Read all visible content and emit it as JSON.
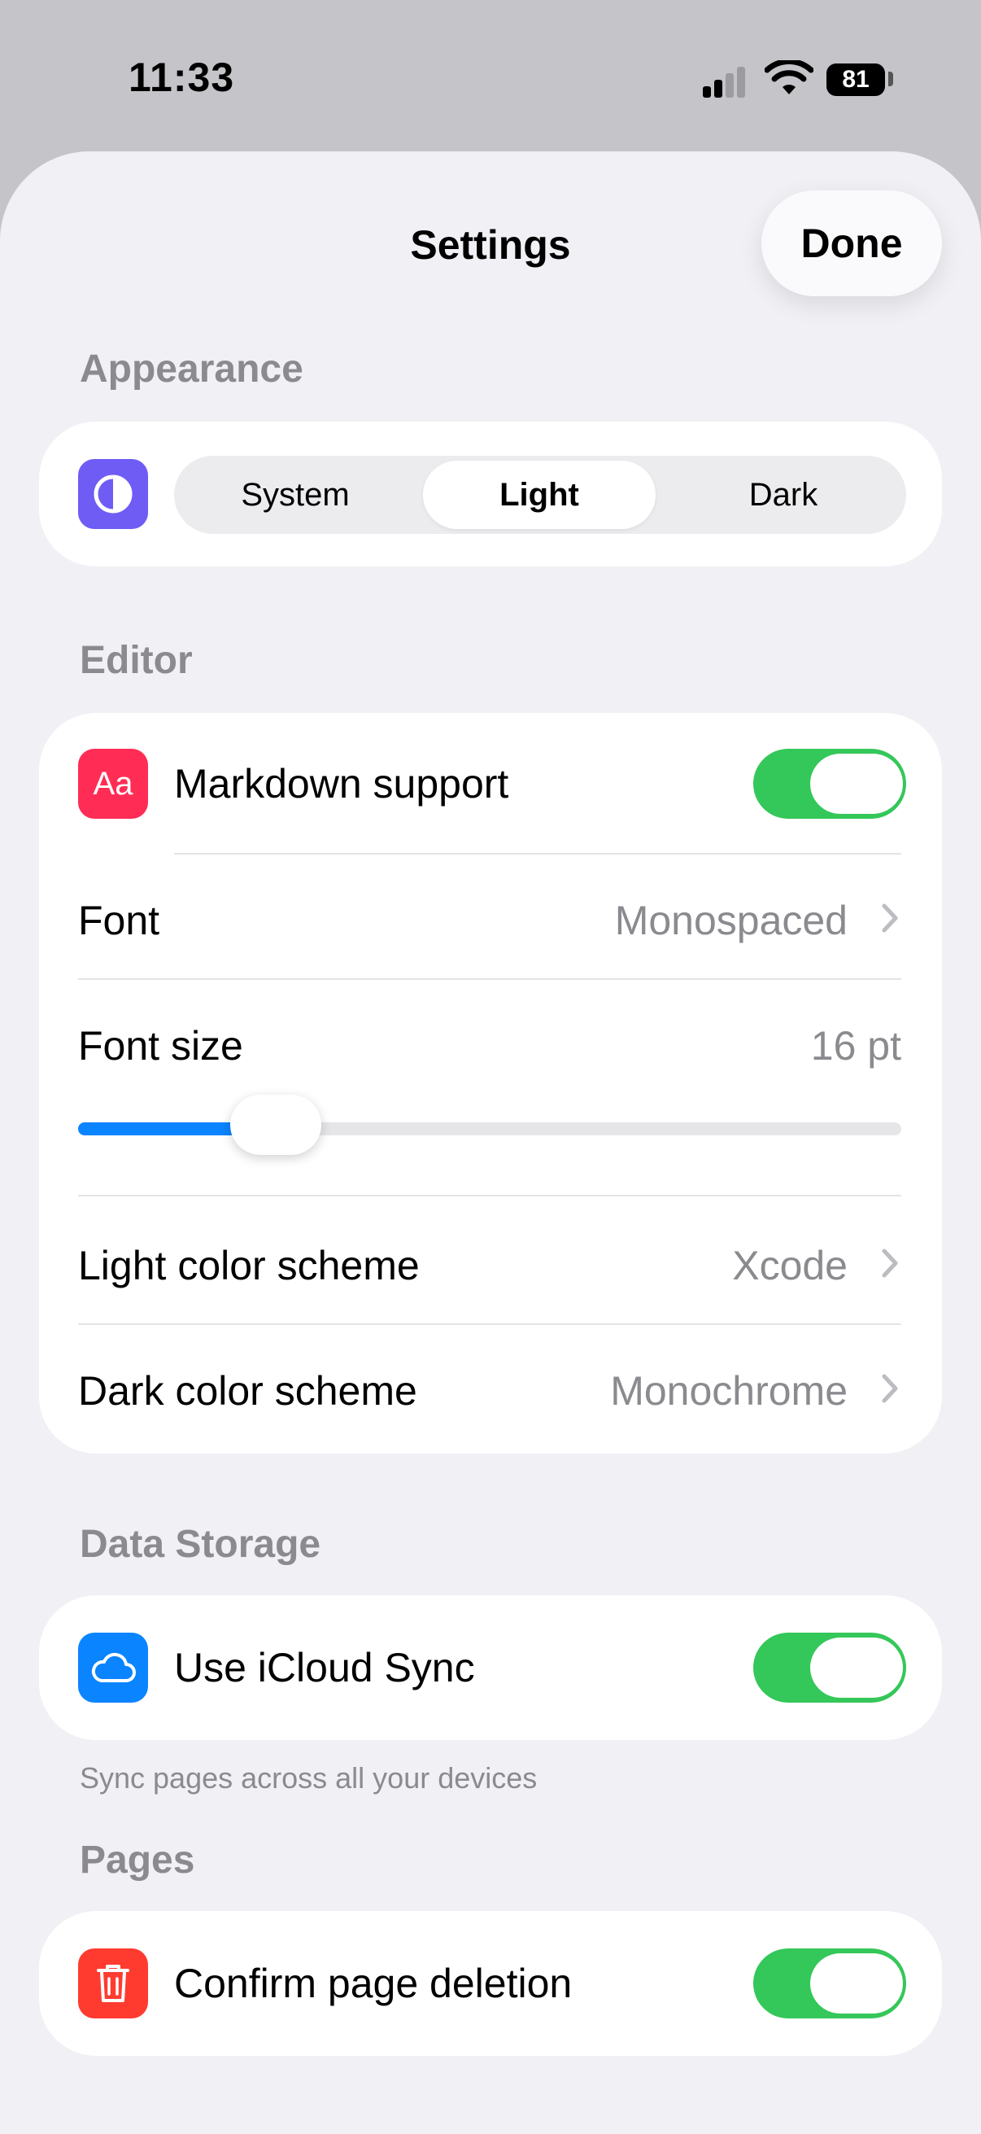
{
  "status_bar": {
    "time": "11:33",
    "battery": "81"
  },
  "sheet": {
    "title": "Settings",
    "done_label": "Done"
  },
  "appearance": {
    "header": "Appearance",
    "icon": "contrast-icon",
    "icon_color": "#6e5cf5",
    "options": [
      "System",
      "Light",
      "Dark"
    ],
    "selected": "Light"
  },
  "editor": {
    "header": "Editor",
    "markdown": {
      "label": "Markdown support",
      "icon_text": "Aa",
      "icon_color": "#ff2d55",
      "enabled": true
    },
    "font": {
      "label": "Font",
      "value": "Monospaced"
    },
    "font_size": {
      "label": "Font size",
      "value": "16 pt",
      "slider_fraction": 0.24
    },
    "light_scheme": {
      "label": "Light color scheme",
      "value": "Xcode"
    },
    "dark_scheme": {
      "label": "Dark color scheme",
      "value": "Monochrome"
    }
  },
  "data_storage": {
    "header": "Data Storage",
    "icloud": {
      "label": "Use iCloud Sync",
      "icon": "cloud-icon",
      "icon_color": "#0a84ff",
      "enabled": true
    },
    "footer": "Sync pages across all your devices"
  },
  "pages": {
    "header": "Pages",
    "confirm_delete": {
      "label": "Confirm page deletion",
      "icon": "trash-icon",
      "icon_color": "#ff3b30",
      "enabled": true
    }
  },
  "colors": {
    "toggle_on": "#34c759",
    "slider_fill": "#0a84ff"
  }
}
